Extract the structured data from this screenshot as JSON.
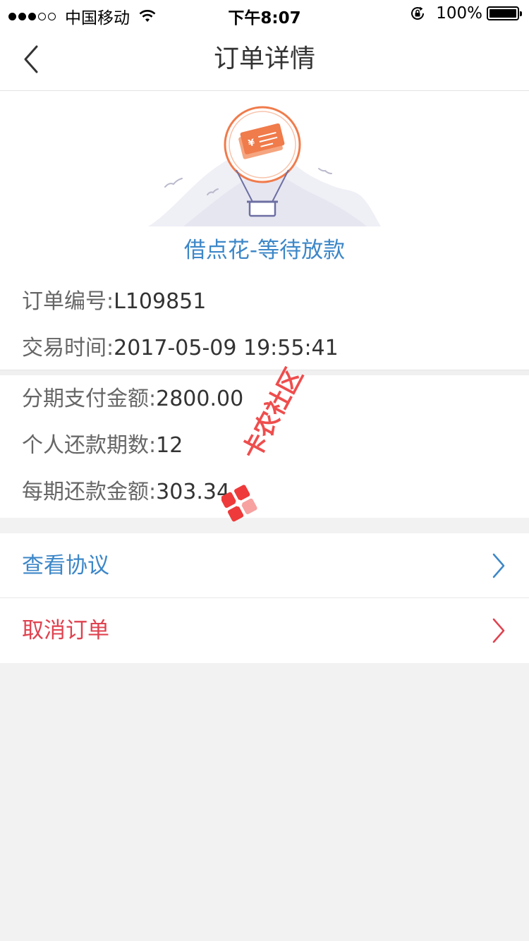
{
  "status_bar": {
    "carrier": "中国移动",
    "time": "下午8:07",
    "battery": "100%"
  },
  "nav": {
    "title": "订单详情"
  },
  "order": {
    "status_title": "借点花-等待放款",
    "order_no_label": "订单编号:",
    "order_no": "L109851",
    "trade_time_label": "交易时间:",
    "trade_time": "2017-05-09 19:55:41",
    "installment_amount_label": "分期支付金额:",
    "installment_amount": "2800.00",
    "periods_label": "个人还款期数:",
    "periods": "12",
    "per_period_label": "每期还款金额:",
    "per_period": "303.34"
  },
  "menu": {
    "agreement": "查看协议",
    "cancel": "取消订单"
  },
  "watermark": {
    "text": "卡农社区"
  },
  "colors": {
    "accent_blue": "#3d87c8",
    "danger_red": "#e0424f",
    "illus_orange": "#f07b4b",
    "illus_purple": "#6d6fa3"
  },
  "icons": {
    "back": "chevron-left-icon",
    "wifi": "wifi-icon",
    "orientation_lock": "orientation-lock-icon",
    "battery": "battery-icon",
    "illustration": "hot-air-balloon-money-icon",
    "agreement_arrow": "chevron-right-icon",
    "cancel_arrow": "chevron-right-icon"
  }
}
